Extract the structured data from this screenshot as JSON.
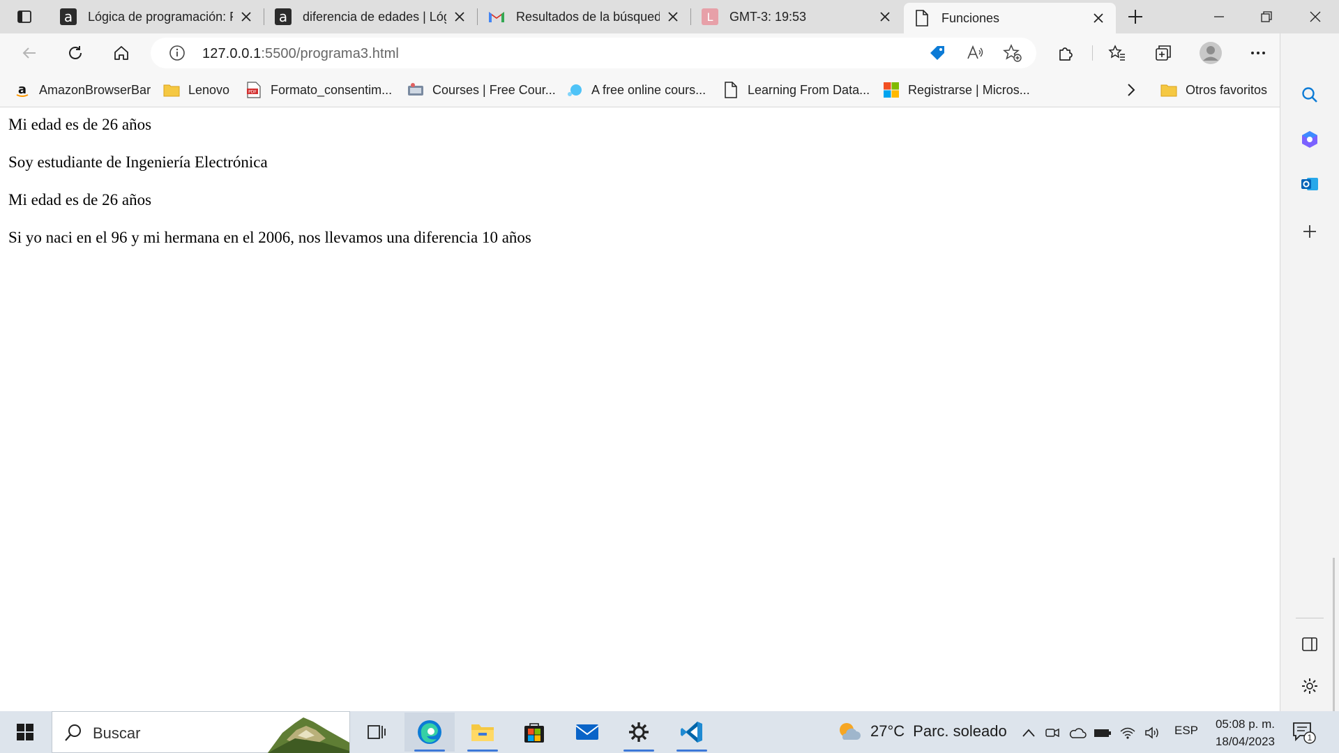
{
  "tabs": [
    {
      "title": "Lógica de programación: F",
      "favicon": "alura-a-icon"
    },
    {
      "title": "diferencia de edades | Lóg",
      "favicon": "alura-a-icon"
    },
    {
      "title": "Resultados de la búsqueda",
      "favicon": "gmail-icon"
    },
    {
      "title": "GMT-3: 19:53",
      "favicon": "letter-l-icon"
    },
    {
      "title": "Funciones",
      "favicon": "page-icon",
      "active": true
    }
  ],
  "address_bar": {
    "host": "127.0.0.1",
    "path": ":5500/programa3.html"
  },
  "bookmarks": [
    {
      "label": "AmazonBrowserBar",
      "icon": "amazon-icon"
    },
    {
      "label": "Lenovo",
      "icon": "folder-icon"
    },
    {
      "label": "Formato_consentim...",
      "icon": "pdf-icon"
    },
    {
      "label": "Courses | Free Cour...",
      "icon": "courses-icon"
    },
    {
      "label": "A free online cours...",
      "icon": "blue-dot-icon"
    },
    {
      "label": "Learning From Data...",
      "icon": "page-icon"
    },
    {
      "label": "Registrarse | Micros...",
      "icon": "microsoft-icon"
    }
  ],
  "other_favorites": "Otros favoritos",
  "page": {
    "lines": [
      "Mi edad es de 26 años",
      "Soy estudiante de Ingeniería Electrónica",
      "Mi edad es de 26 años",
      "Si yo naci en el 96 y mi hermana en el 2006, nos llevamos una diferencia 10 años"
    ]
  },
  "taskbar": {
    "search_placeholder": "Buscar",
    "weather": {
      "temp": "27°C",
      "condition": "Parc. soleado"
    },
    "language": "ESP",
    "time": "05:08 p. m.",
    "date": "18/04/2023",
    "notification_count": "1"
  },
  "colors": {
    "accent": "#3c78d8",
    "edge_blue": "#0c7bd6"
  }
}
